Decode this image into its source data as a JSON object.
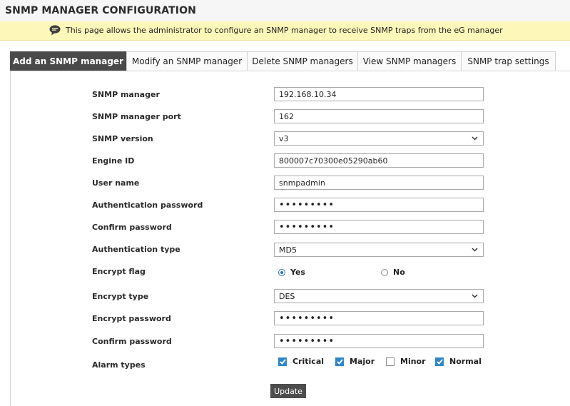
{
  "page_title": "SNMP MANAGER CONFIGURATION",
  "info_message": "This page allows the administrator to configure an SNMP manager to receive SNMP traps from the eG manager",
  "tabs": [
    {
      "label": "Add an SNMP manager",
      "active": true
    },
    {
      "label": "Modify an SNMP manager",
      "active": false
    },
    {
      "label": "Delete SNMP managers",
      "active": false
    },
    {
      "label": "View SNMP managers",
      "active": false
    },
    {
      "label": "SNMP trap settings",
      "active": false
    }
  ],
  "form": {
    "snmp_manager": {
      "label": "SNMP manager",
      "value": "192.168.10.34"
    },
    "snmp_manager_port": {
      "label": "SNMP manager port",
      "value": "162"
    },
    "snmp_version": {
      "label": "SNMP version",
      "value": "v3"
    },
    "engine_id": {
      "label": "Engine ID",
      "value": "800007c70300e05290ab60"
    },
    "user_name": {
      "label": "User name",
      "value": "snmpadmin"
    },
    "auth_password": {
      "label": "Authentication password",
      "value": "•••••••••"
    },
    "confirm_auth_password": {
      "label": "Confirm password",
      "value": "•••••••••"
    },
    "auth_type": {
      "label": "Authentication type",
      "value": "MD5"
    },
    "encrypt_flag": {
      "label": "Encrypt flag",
      "options": [
        "Yes",
        "No"
      ],
      "selected": "Yes"
    },
    "encrypt_type": {
      "label": "Encrypt type",
      "value": "DES"
    },
    "encrypt_password": {
      "label": "Encrypt password",
      "value": "•••••••••"
    },
    "confirm_encrypt_password": {
      "label": "Confirm password",
      "value": "•••••••••"
    },
    "alarm_types": {
      "label": "Alarm types",
      "options": [
        {
          "label": "Critical",
          "checked": true
        },
        {
          "label": "Major",
          "checked": true
        },
        {
          "label": "Minor",
          "checked": false
        },
        {
          "label": "Normal",
          "checked": true
        }
      ]
    }
  },
  "update_label": "Update",
  "colors": {
    "accent": "#2f86c8",
    "tab_active": "#4a4a4a",
    "info_bg": "#fdf7b9"
  }
}
